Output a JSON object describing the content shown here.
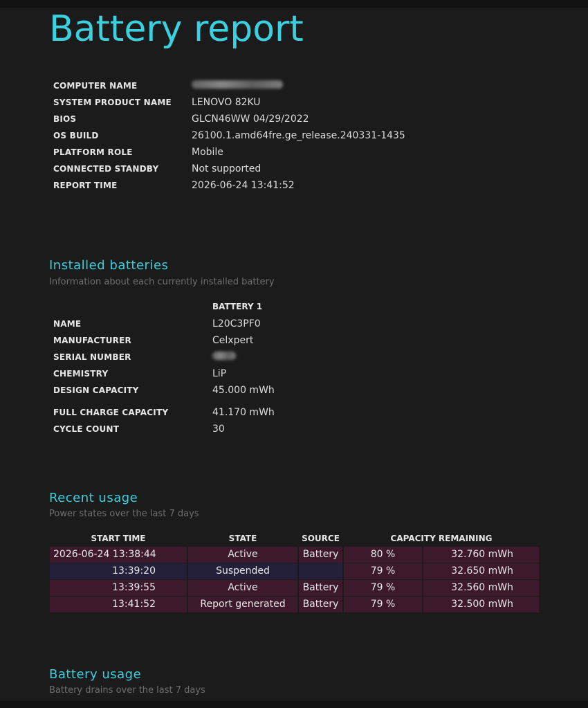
{
  "title": "Battery report",
  "system_info": [
    {
      "label": "COMPUTER NAME",
      "value": "",
      "redacted": true
    },
    {
      "label": "SYSTEM PRODUCT NAME",
      "value": "LENOVO 82KU"
    },
    {
      "label": "BIOS",
      "value": "GLCN46WW 04/29/2022"
    },
    {
      "label": "OS BUILD",
      "value": "26100.1.amd64fre.ge_release.240331-1435"
    },
    {
      "label": "PLATFORM ROLE",
      "value": "Mobile"
    },
    {
      "label": "CONNECTED STANDBY",
      "value": "Not supported"
    },
    {
      "label": "REPORT TIME",
      "value": "2026-06-24  13:41:52"
    }
  ],
  "installed_batteries": {
    "title": "Installed batteries",
    "subtitle": "Information about each currently installed battery",
    "column_header": "BATTERY 1",
    "rows": [
      {
        "label": "NAME",
        "value": "L20C3PF0"
      },
      {
        "label": "MANUFACTURER",
        "value": "Celxpert"
      },
      {
        "label": "SERIAL NUMBER",
        "value": "",
        "redacted": true
      },
      {
        "label": "CHEMISTRY",
        "value": "LiP"
      },
      {
        "label": "DESIGN CAPACITY",
        "value": "45.000 mWh"
      },
      {
        "label": "FULL CHARGE CAPACITY",
        "value": "41.170 mWh"
      },
      {
        "label": "CYCLE COUNT",
        "value": "30"
      }
    ]
  },
  "recent_usage": {
    "title": "Recent usage",
    "subtitle": "Power states over the last 7 days",
    "headers": [
      "START TIME",
      "STATE",
      "SOURCE",
      "CAPACITY REMAINING"
    ],
    "rows": [
      {
        "start": "2026-06-24  13:38:44",
        "state": "Active",
        "source": "Battery",
        "pct": "80 %",
        "cap": "32.760 mWh"
      },
      {
        "start": "13:39:20",
        "state": "Suspended",
        "source": "",
        "pct": "79 %",
        "cap": "32.650 mWh"
      },
      {
        "start": "13:39:55",
        "state": "Active",
        "source": "Battery",
        "pct": "79 %",
        "cap": "32.560 mWh"
      },
      {
        "start": "13:41:52",
        "state": "Report generated",
        "source": "Battery",
        "pct": "79 %",
        "cap": "32.500 mWh"
      }
    ]
  },
  "battery_usage": {
    "title": "Battery usage",
    "subtitle": "Battery drains over the last 7 days"
  },
  "colors": {
    "accent": "#3cd0de",
    "background": "#1b1b1b",
    "row_active": "#3c1a2b",
    "row_suspended": "#24203a"
  }
}
